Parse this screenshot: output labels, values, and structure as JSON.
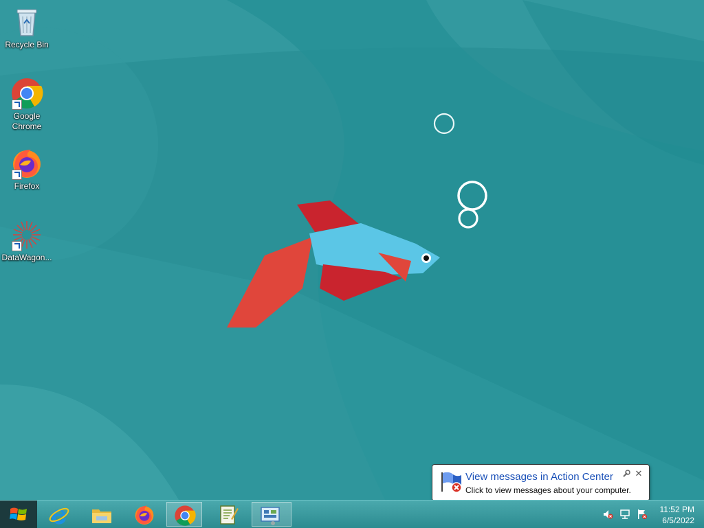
{
  "desktop": {
    "icons": [
      {
        "label": "Recycle Bin",
        "icon": "recycle-bin-icon"
      },
      {
        "label": "Google Chrome",
        "icon": "chrome-icon"
      },
      {
        "label": "Firefox",
        "icon": "firefox-icon"
      },
      {
        "label": "DataWagon...",
        "icon": "datawagon-icon"
      }
    ]
  },
  "taskbar": {
    "pinned": [
      {
        "name": "Internet Explorer",
        "icon": "internet-explorer-icon"
      },
      {
        "name": "File Explorer",
        "icon": "file-explorer-icon"
      },
      {
        "name": "Firefox",
        "icon": "firefox-icon"
      },
      {
        "name": "Google Chrome",
        "icon": "chrome-icon"
      },
      {
        "name": "Notepad++",
        "icon": "notepad-plus-plus-icon"
      },
      {
        "name": "Control Panel",
        "icon": "control-panel-icon"
      }
    ],
    "tray": {
      "clock_time": "11:52 PM",
      "clock_date": "6/5/2022"
    }
  },
  "balloon": {
    "title": "View messages in Action Center",
    "body": "Click to view messages about your computer.",
    "close_glyph": "✕"
  },
  "colors": {
    "wallpaper": "#2b9197",
    "taskbar": "#3b9ea3",
    "balloon_title": "#1a50b8"
  }
}
